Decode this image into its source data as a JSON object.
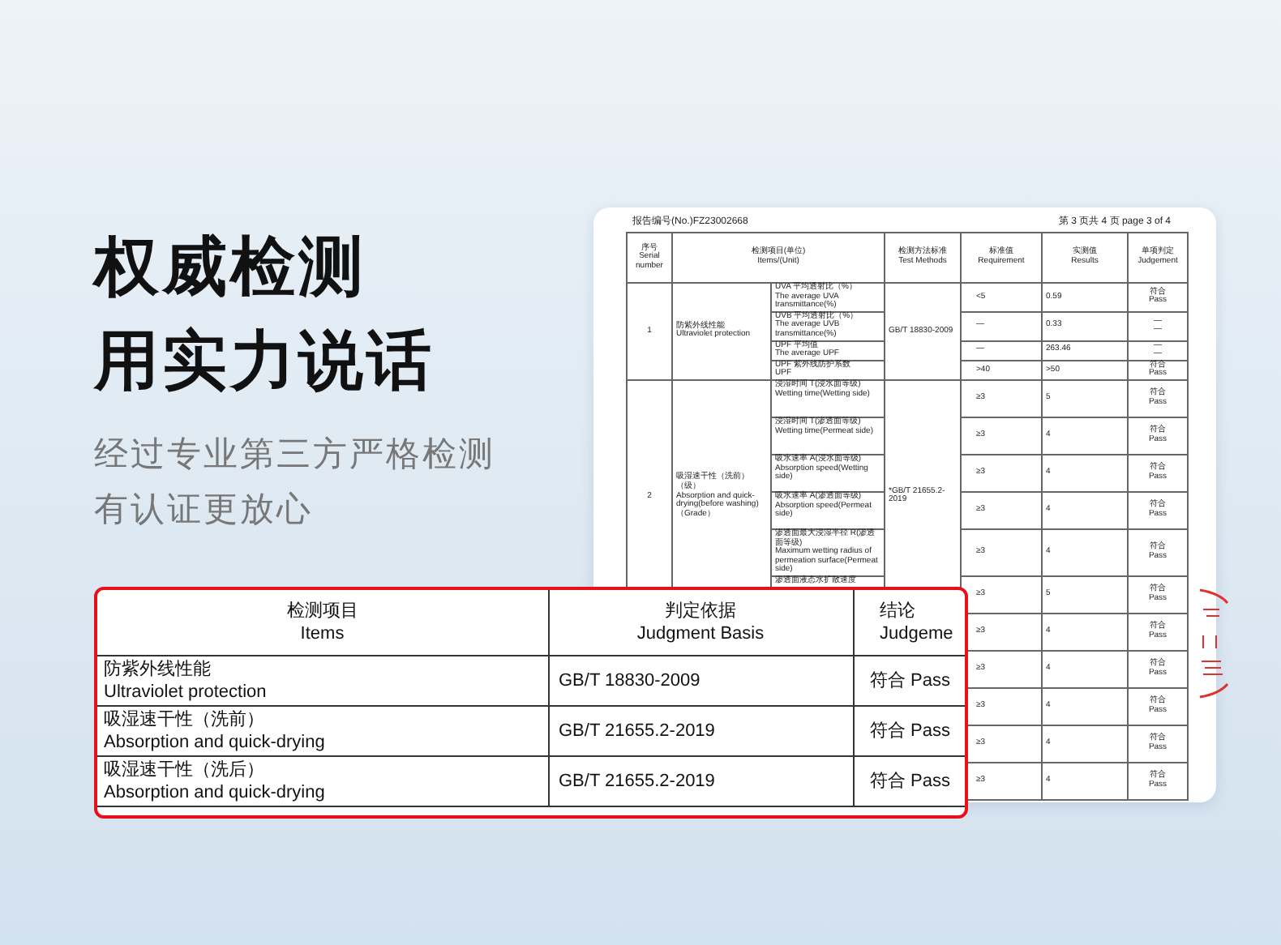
{
  "headline": [
    "权威检测",
    "用实力说话"
  ],
  "subtitle": [
    "经过专业第三方严格检测",
    "有认证更放心"
  ],
  "report": {
    "report_no": "报告编号(No.)FZ23002668",
    "page": "第 3 页共 4 页 page 3 of 4",
    "columns": [
      {
        "zh": "序号",
        "en": "Serial number"
      },
      {
        "zh": "检测项目(单位)",
        "en": "Items/(Unit)"
      },
      {
        "zh": "检测方法标准",
        "en": "Test Methods"
      },
      {
        "zh": "标准值",
        "en": "Requirement"
      },
      {
        "zh": "实测值",
        "en": "Results"
      },
      {
        "zh": "单项判定",
        "en": "Judgement"
      }
    ],
    "groups": [
      {
        "kind": "compact",
        "serial": "1",
        "item_zh": "防紫外线性能",
        "item_en": "Ultraviolet protection",
        "method": "GB/T 18830-2009",
        "rows": [
          {
            "sub_zh": "UVA 平均透射比（%）",
            "sub_en": "The average UVA transmittance(%)",
            "requirement": "<5",
            "result": "0.59",
            "judgement_zh": "符合",
            "judgement_en": "Pass"
          },
          {
            "sub_zh": "UVB 平均透射比（%）",
            "sub_en": "The average UVB transmittance(%)",
            "requirement": "—",
            "result": "0.33",
            "judgement_zh": "—",
            "judgement_en": "—"
          },
          {
            "sub_zh": "UPF 平均值",
            "sub_en": "The average UPF",
            "requirement": "—",
            "result": "263.46",
            "judgement_zh": "—",
            "judgement_en": "—"
          },
          {
            "sub_zh": "UPF 紫外线防护系数",
            "sub_en": "UPF",
            "requirement": ">40",
            "result": ">50",
            "judgement_zh": "符合",
            "judgement_en": "Pass"
          }
        ]
      },
      {
        "kind": "tall",
        "serial": "2",
        "item_zh": "吸湿速干性（洗前）（级）",
        "item_en": "Absorption and quick-drying(before washing)（Grade）",
        "method": "*GB/T 21655.2-2019",
        "rows": [
          {
            "sub_zh": "浸湿时间 T(浸水面等级)",
            "sub_en": "Wetting time(Wetting side)",
            "requirement": "≥3",
            "result": "5",
            "judgement_zh": "符合",
            "judgement_en": "Pass"
          },
          {
            "sub_zh": "浸湿时间 T(渗透面等级)",
            "sub_en": "Wetting time(Permeat side)",
            "requirement": "≥3",
            "result": "4",
            "judgement_zh": "符合",
            "judgement_en": "Pass"
          },
          {
            "sub_zh": "吸水速率 A(浸水面等级)",
            "sub_en": "Absorption speed(Wetting side)",
            "requirement": "≥3",
            "result": "4",
            "judgement_zh": "符合",
            "judgement_en": "Pass"
          },
          {
            "sub_zh": "吸水速率 A(渗透面等级)",
            "sub_en": "Absorption speed(Permeat side)",
            "requirement": "≥3",
            "result": "4",
            "judgement_zh": "符合",
            "judgement_en": "Pass"
          },
          {
            "sub_zh": "渗透面最大浸湿半径 R(渗透面等级)",
            "sub_en": "Maximum wetting radius of permeation surface(Permeat side)",
            "requirement": "≥3",
            "result": "4",
            "judgement_zh": "符合",
            "judgement_en": "Pass"
          },
          {
            "sub_zh": "渗透面液态水扩散速度",
            "requirement": "≥3",
            "result": "5",
            "judgement_zh": "符合",
            "judgement_en": "Pass"
          }
        ]
      },
      {
        "kind": "tall",
        "rows": [
          {
            "requirement": "≥3",
            "result": "4",
            "judgement_zh": "符合",
            "judgement_en": "Pass"
          },
          {
            "requirement": "≥3",
            "result": "4",
            "judgement_zh": "符合",
            "judgement_en": "Pass"
          },
          {
            "requirement": "≥3",
            "result": "4",
            "judgement_zh": "符合",
            "judgement_en": "Pass"
          },
          {
            "requirement": "≥3",
            "result": "4",
            "judgement_zh": "符合",
            "judgement_en": "Pass"
          },
          {
            "requirement": "≥3",
            "result": "4",
            "judgement_zh": "符合",
            "judgement_en": "Pass"
          }
        ]
      }
    ]
  },
  "callout": {
    "columns": [
      {
        "zh": "检测项目",
        "en": "Items"
      },
      {
        "zh": "判定依据",
        "en": "Judgment Basis"
      },
      {
        "zh": "结论",
        "en": "Judgeme"
      }
    ],
    "rows": [
      {
        "item_zh": "防紫外线性能",
        "item_en": "Ultraviolet protection",
        "basis": "GB/T 18830-2009",
        "conclusion": "符合  Pass"
      },
      {
        "item_zh": "吸湿速干性（洗前）",
        "item_en": "Absorption and quick-drying",
        "basis": "GB/T 21655.2-2019",
        "conclusion": "符合  Pass"
      },
      {
        "item_zh": "吸湿速干性（洗后）",
        "item_en": "Absorption and quick-drying",
        "basis": "GB/T 21655.2-2019",
        "conclusion": "符合  Pass"
      }
    ]
  }
}
